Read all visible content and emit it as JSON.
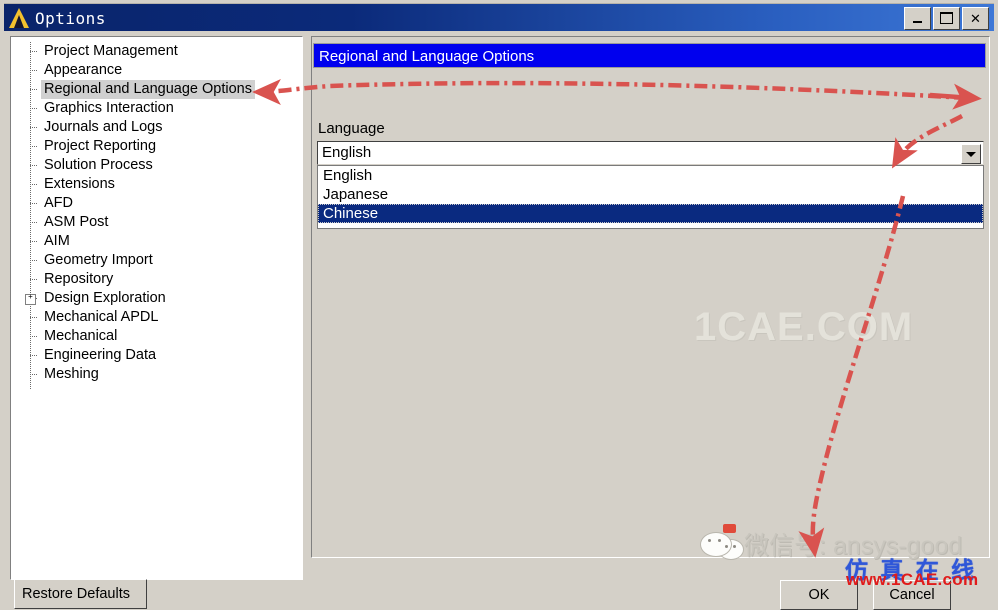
{
  "window": {
    "title": "Options",
    "logo_icon": "ansys-logo-icon",
    "buttons": {
      "minimize": "minimize-icon",
      "maximize": "maximize-icon",
      "close": "✕"
    }
  },
  "tree": {
    "items": [
      {
        "label": "Project Management",
        "expandable": false,
        "selected": false
      },
      {
        "label": "Appearance",
        "expandable": false,
        "selected": false
      },
      {
        "label": "Regional and Language Options",
        "expandable": false,
        "selected": true
      },
      {
        "label": "Graphics Interaction",
        "expandable": false,
        "selected": false
      },
      {
        "label": "Journals and Logs",
        "expandable": false,
        "selected": false
      },
      {
        "label": "Project Reporting",
        "expandable": false,
        "selected": false
      },
      {
        "label": "Solution Process",
        "expandable": false,
        "selected": false
      },
      {
        "label": "Extensions",
        "expandable": false,
        "selected": false
      },
      {
        "label": "AFD",
        "expandable": false,
        "selected": false
      },
      {
        "label": "ASM Post",
        "expandable": false,
        "selected": false
      },
      {
        "label": "AIM",
        "expandable": false,
        "selected": false
      },
      {
        "label": "Geometry Import",
        "expandable": false,
        "selected": false
      },
      {
        "label": "Repository",
        "expandable": false,
        "selected": false
      },
      {
        "label": "Design Exploration",
        "expandable": true,
        "selected": false
      },
      {
        "label": "Mechanical APDL",
        "expandable": false,
        "selected": false
      },
      {
        "label": "Mechanical",
        "expandable": false,
        "selected": false
      },
      {
        "label": "Engineering Data",
        "expandable": false,
        "selected": false
      },
      {
        "label": "Meshing",
        "expandable": false,
        "selected": false
      }
    ]
  },
  "panel": {
    "section_title": "Regional and Language Options",
    "language_label": "Language",
    "language_value": "English",
    "dropdown_icon": "chevron-down-icon",
    "options": [
      {
        "label": "English",
        "selected": false
      },
      {
        "label": "Japanese",
        "selected": false
      },
      {
        "label": "Chinese",
        "selected": true
      }
    ]
  },
  "footer": {
    "restore_defaults": "Restore Defaults",
    "ok": "OK",
    "cancel": "Cancel"
  },
  "watermarks": {
    "centre": "1CAE.COM",
    "wechat_icon": "wechat-icon",
    "wechat_text": "微信号: ansys-good",
    "simulation_online": "仿 真 在 线",
    "url": "www.1CAE.com"
  },
  "colors": {
    "titlebar_start": "#0a246a",
    "titlebar_end": "#3d77d6",
    "section_header": "#0000ee",
    "selection": "#0a2a80",
    "face": "#d4d0c8",
    "annotation_red": "#d9534f",
    "brand_red": "#e01b1b",
    "brand_blue": "#2f57d8"
  },
  "annotations": {
    "arrow_color": "#d9534f",
    "arrow_1": "tree item to section header",
    "arrow_2": "section header to dropdown button",
    "arrow_3": "dropdown button to Chinese option",
    "arrow_4": "dropdown area down to OK button"
  }
}
